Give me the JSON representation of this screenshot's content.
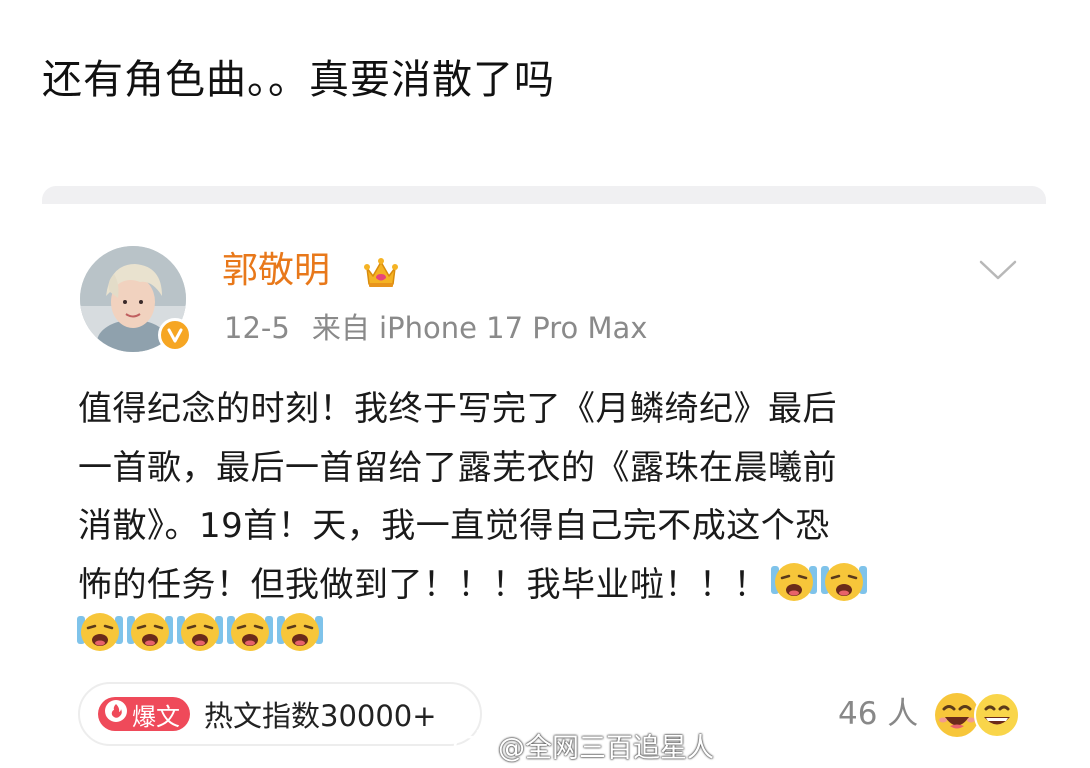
{
  "caption": "还有角色曲。。真要消散了吗",
  "post": {
    "username": "郭敬明",
    "date": "12-5",
    "source": "来自 iPhone 17 Pro Max",
    "text_lines": [
      "值得纪念的时刻！我终于写完了《月鳞绮纪》最后",
      "一首歌，最后一首留给了露芜衣的《露珠在晨曦前",
      "消散》。19首！天，我一直觉得自己完不成这个恐",
      "怖的任务！但我做到了！！！我毕业啦！！！"
    ],
    "hot_badge": "爆文",
    "hot_index": "热文指数30000+",
    "reaction_count": "46 人"
  },
  "icons": {
    "avatar": "avatar",
    "verified": "verified-v-icon",
    "crown": "crown-icon",
    "dropdown": "chevron-down-icon",
    "emoji_crying": "loudly-crying-emoji",
    "emoji_laugh": "laughing-emoji",
    "weibo": "weibo-logo-icon"
  },
  "colors": {
    "username": "#e8781a",
    "meta": "#8a8a8a",
    "hot_badge": "#ef4a5a",
    "verified": "#f6a623"
  },
  "watermark": "@全网三百追星人"
}
